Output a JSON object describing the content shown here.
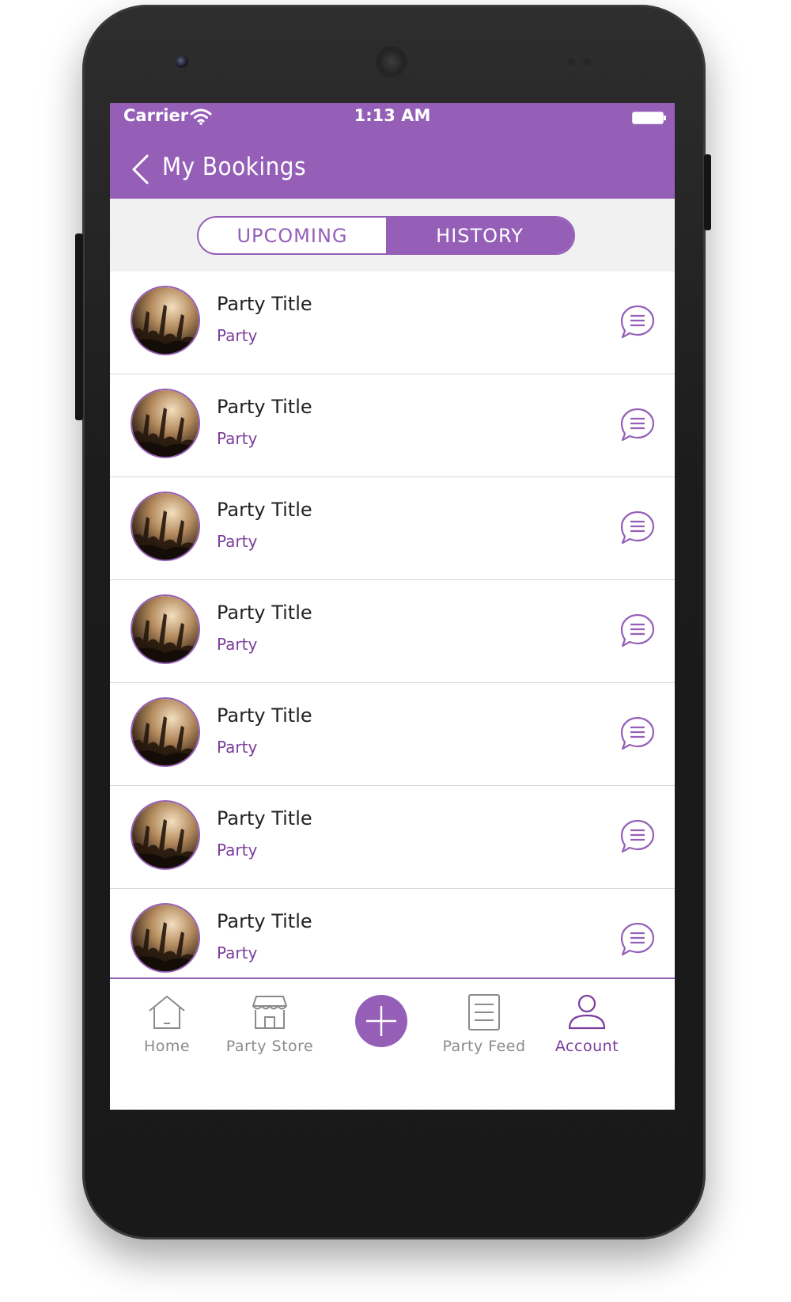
{
  "status_bar": {
    "carrier": "Carrier",
    "time": "1:13 AM",
    "wifi_icon": "wifi-icon",
    "battery_icon": "battery-icon"
  },
  "header": {
    "back_icon": "chevron-left-icon",
    "title": "My Bookings"
  },
  "tabs": {
    "items": [
      {
        "label": "UPCOMING",
        "active": false
      },
      {
        "label": "HISTORY",
        "active": true
      }
    ]
  },
  "bookings": [
    {
      "title": "Party Title",
      "subtitle": "Party"
    },
    {
      "title": "Party Title",
      "subtitle": "Party"
    },
    {
      "title": "Party Title",
      "subtitle": "Party"
    },
    {
      "title": "Party Title",
      "subtitle": "Party"
    },
    {
      "title": "Party Title",
      "subtitle": "Party"
    },
    {
      "title": "Party Title",
      "subtitle": "Party"
    },
    {
      "title": "Party Title",
      "subtitle": "Party"
    }
  ],
  "bottom_nav": {
    "items": [
      {
        "label": "Home",
        "icon": "home-icon",
        "active": false
      },
      {
        "label": "Party Store",
        "icon": "store-icon",
        "active": false
      },
      {
        "label": "Party Feed",
        "icon": "feed-icon",
        "active": false
      },
      {
        "label": "Account",
        "icon": "user-icon",
        "active": true
      }
    ],
    "fab_icon": "plus-icon"
  },
  "colors": {
    "primary": "#955fb8",
    "accent_text": "#7a3d9c",
    "inactive": "#8b8b8b",
    "tab_background": "#f1f1f1"
  }
}
